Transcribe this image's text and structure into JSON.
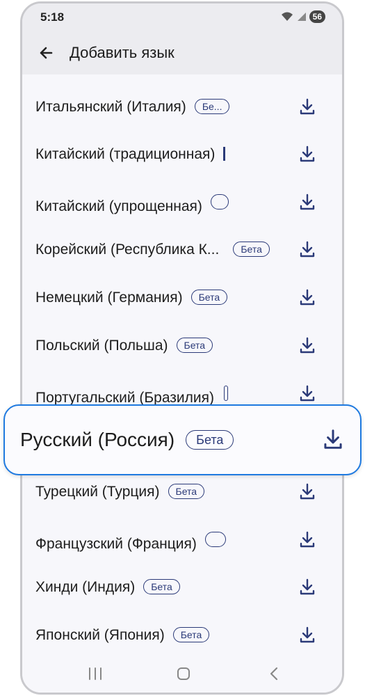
{
  "status": {
    "time": "5:18",
    "battery": "56"
  },
  "appbar": {
    "title": "Добавить язык"
  },
  "languages": [
    {
      "name": "Итальянский (Италия)",
      "badge": "Бе..."
    },
    {
      "name": "Китайский (традиционная)",
      "badge": ""
    },
    {
      "name": "Китайский (упрощенная)",
      "badge": ""
    },
    {
      "name": "Корейский (Республика К...",
      "badge": "Бета"
    },
    {
      "name": "Немецкий (Германия)",
      "badge": "Бета"
    },
    {
      "name": "Польский (Польша)",
      "badge": "Бета"
    },
    {
      "name": "Португальский (Бразилия)",
      "badge": ""
    },
    {
      "name": "Турецкий (Турция)",
      "badge": "Бета"
    },
    {
      "name": "Французский (Франция)",
      "badge": ""
    },
    {
      "name": "Хинди (Индия)",
      "badge": "Бета"
    },
    {
      "name": "Японский (Япония)",
      "badge": "Бета"
    }
  ],
  "highlight": {
    "name": "Русский (Россия)",
    "badge": "Бета"
  },
  "icons": {
    "back": "arrow-left-icon",
    "download": "download-icon",
    "wifi": "wifi-icon",
    "signal": "signal-icon"
  }
}
